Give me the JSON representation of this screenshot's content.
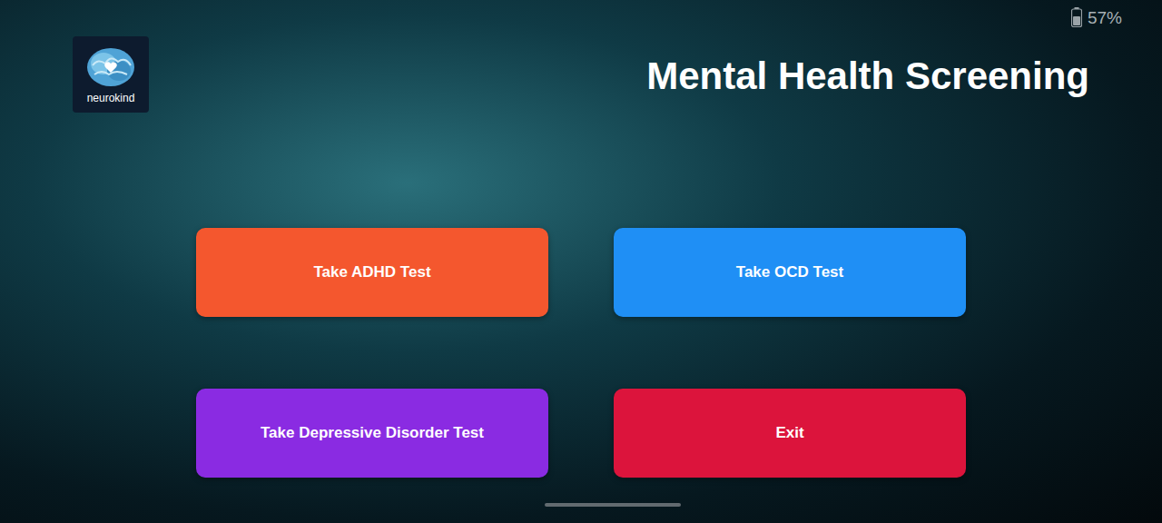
{
  "status_bar": {
    "battery": "57%"
  },
  "logo": {
    "label": "neurokind"
  },
  "title": "Mental Health Screening",
  "buttons": [
    {
      "label": "Take ADHD Test",
      "color": "#f4572e"
    },
    {
      "label": "Take OCD Test",
      "color": "#1f8ff5"
    },
    {
      "label": "Take Depressive Disorder Test",
      "color": "#8a2be2"
    },
    {
      "label": "Exit",
      "color": "#dc143c"
    }
  ]
}
